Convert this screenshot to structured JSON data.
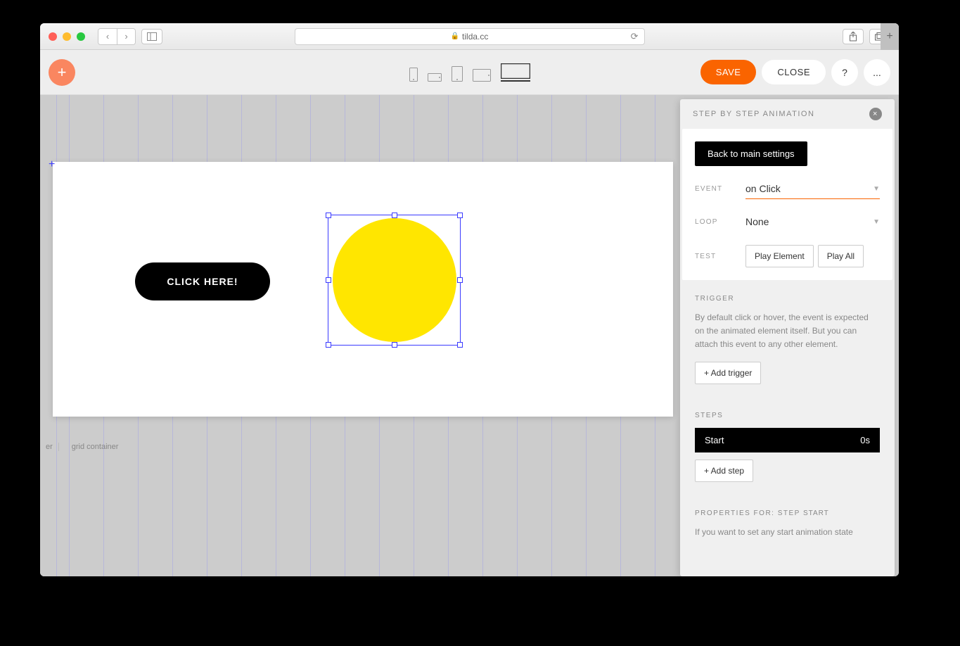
{
  "browser": {
    "url": "tilda.cc"
  },
  "topbar": {
    "save": "SAVE",
    "close": "CLOSE",
    "help": "?",
    "more": "..."
  },
  "canvas": {
    "button_label": "CLICK HERE!",
    "breadcrumb_1": "er",
    "breadcrumb_2": "grid container"
  },
  "panel": {
    "title": "STEP BY STEP ANIMATION",
    "back": "Back to main settings",
    "event_label": "EVENT",
    "event_value": "on Click",
    "loop_label": "LOOP",
    "loop_value": "None",
    "test_label": "TEST",
    "play_element": "Play Element",
    "play_all": "Play All",
    "trigger_title": "TRIGGER",
    "trigger_help": "By default click or hover, the event is expected on the animated element itself. But you can attach this event to any other element.",
    "add_trigger": "+ Add trigger",
    "steps_title": "STEPS",
    "step_start_name": "Start",
    "step_start_time": "0s",
    "add_step": "+ Add step",
    "properties_prefix": "PROPERTIES FOR: STEP ",
    "properties_step": "START",
    "properties_help": "If you want to set any start animation state"
  }
}
